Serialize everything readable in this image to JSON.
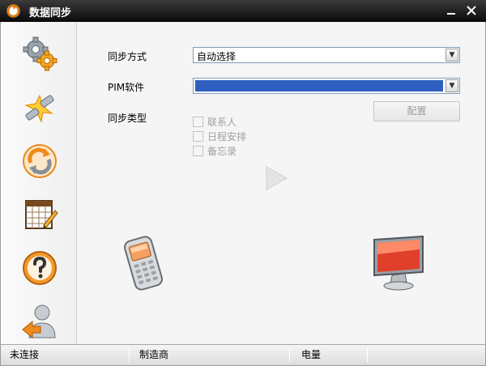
{
  "window": {
    "title": "数据同步",
    "icon": "sync-app-icon"
  },
  "sidebar": {
    "items": [
      {
        "name": "settings",
        "icon": "gears-icon"
      },
      {
        "name": "connect",
        "icon": "plug-connect-icon"
      },
      {
        "name": "sync",
        "icon": "sync-arrows-icon"
      },
      {
        "name": "calendar",
        "icon": "calendar-edit-icon"
      },
      {
        "name": "help",
        "icon": "help-icon"
      },
      {
        "name": "user",
        "icon": "user-back-icon"
      }
    ]
  },
  "form": {
    "sync_mode_label": "同步方式",
    "sync_mode_value": "自动选择",
    "pim_label": "PIM软件",
    "pim_value": "",
    "sync_type_label": "同步类型",
    "config_button": "配置",
    "types": [
      {
        "label": "联系人",
        "checked": false
      },
      {
        "label": "日程安排",
        "checked": false
      },
      {
        "label": "备忘录",
        "checked": false
      }
    ]
  },
  "statusbar": {
    "connection": "未连接",
    "manufacturer": "制造商",
    "battery": "电量"
  },
  "colors": {
    "titlebar": "#0c0c0c",
    "selection": "#2f5fc0",
    "accent": "#f08a1c"
  }
}
